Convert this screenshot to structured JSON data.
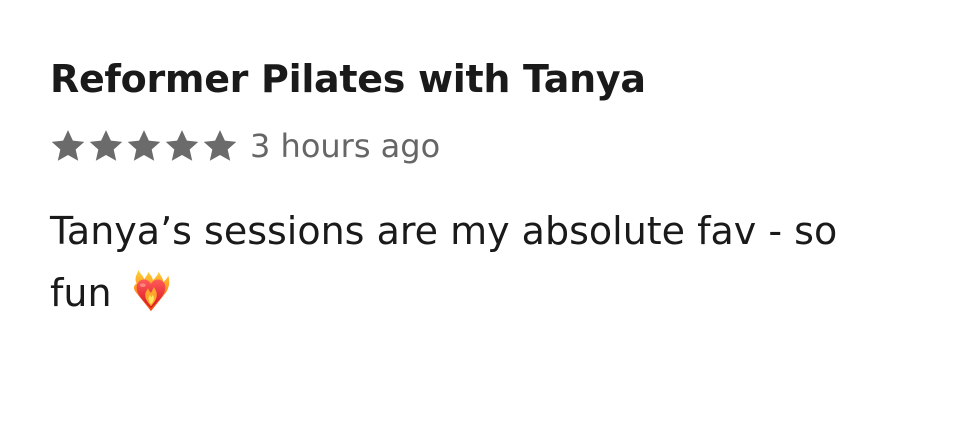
{
  "review": {
    "title": "Reformer Pilates with Tanya",
    "rating": 5,
    "rating_max": 5,
    "timestamp": "3 hours ago",
    "body_text": "Tanya’s sessions are my absolute fav - so fun",
    "emoji": "heart-on-fire-icon"
  },
  "colors": {
    "title": "#1a1a1a",
    "star": "#6b6b6b",
    "timestamp": "#666666",
    "body": "#1a1a1a"
  }
}
